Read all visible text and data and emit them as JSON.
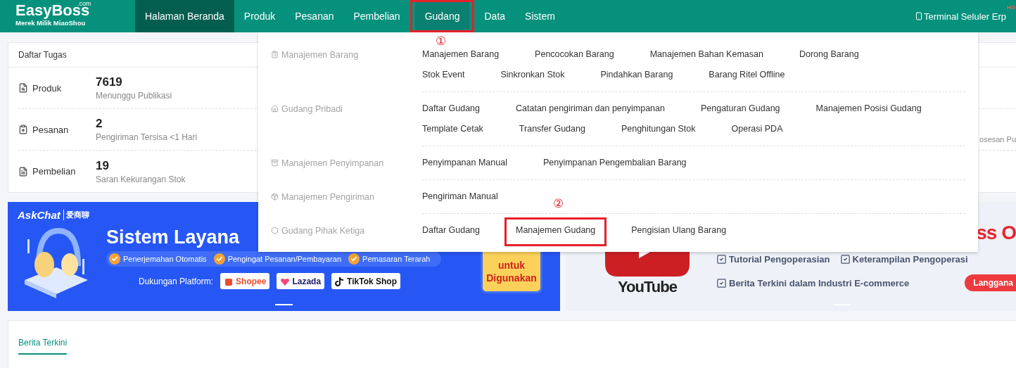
{
  "header": {
    "logo": {
      "name": "EasyBoss",
      "domain": ".com",
      "tagline": "Merek Milik MiaoShou"
    },
    "nav": [
      {
        "label": "Halaman Beranda",
        "selected": true,
        "open": false
      },
      {
        "label": "Produk",
        "selected": false,
        "open": false
      },
      {
        "label": "Pesanan",
        "selected": false,
        "open": false
      },
      {
        "label": "Pembelian",
        "selected": false,
        "open": false
      },
      {
        "label": "Gudang",
        "selected": false,
        "open": true,
        "callout": "①"
      },
      {
        "label": "Data",
        "selected": false,
        "open": false
      },
      {
        "label": "Sistem",
        "selected": false,
        "open": false
      }
    ],
    "mobile_link": {
      "label": "Terminal Seluler Erp",
      "badge": "HO"
    }
  },
  "tasks": {
    "title": "Daftar Tugas",
    "rows": [
      {
        "label": "Produk",
        "count": "7619",
        "caption": "Menunggu Publikasi"
      },
      {
        "label": "Pesanan",
        "count": "2",
        "caption": "Pengiriman Tersisa <1 Hari",
        "column_2": "osesan Pu"
      },
      {
        "label": "Pembelian",
        "count": "19",
        "caption": "Saran Kekurangan Stok"
      }
    ]
  },
  "banners": {
    "left": {
      "brand": "AskChat",
      "brand_cn": "爱商聊",
      "title": "Sistem Layana",
      "features": [
        "Penerjemahan Otomatis",
        "Pengingat Pesanan/Pembayaran",
        "Pemasaran Terarah"
      ],
      "platform_label": "Dukungan Platform:",
      "platforms": [
        "Shopee",
        "Lazada",
        "**TikTok** Shop"
      ],
      "promo": [
        "untuk",
        "Digunakan"
      ]
    },
    "right": {
      "headline": "ss O",
      "video_brand": "YouTube",
      "checklist": [
        "Tutorial Pengoperasian",
        "Keterampilan Pengoperasi",
        "Berita Terkini dalam Industri E-commerce"
      ],
      "button": "Langgana"
    }
  },
  "news": {
    "tabs": [
      {
        "label": "Berita Terkini",
        "selected": true
      }
    ]
  },
  "menu": {
    "groups": [
      {
        "label": "Manajemen Barang",
        "items": [
          {
            "label": "Manajemen Barang"
          },
          {
            "label": "Pencocokan Barang"
          },
          {
            "label": "Manajemen Bahan Kemasan"
          },
          {
            "label": "Dorong Barang"
          },
          {
            "label": "Stok Event"
          },
          {
            "label": "Sinkronkan Stok"
          },
          {
            "label": "Pindahkan Barang"
          },
          {
            "label": "Barang Ritel Offline"
          }
        ]
      },
      {
        "label": "Gudang Pribadi",
        "items": [
          {
            "label": "Daftar Gudang"
          },
          {
            "label": "Catatan pengiriman dan penyimpanan"
          },
          {
            "label": "Pengaturan Gudang"
          },
          {
            "label": "Manajemen Posisi Gudang"
          },
          {
            "label": "Template Cetak"
          },
          {
            "label": "Transfer Gudang"
          },
          {
            "label": "Penghitungan Stok"
          },
          {
            "label": "Operasi PDA"
          }
        ]
      },
      {
        "label": "Manajemen Penyimpanan",
        "items": [
          {
            "label": "Penyimpanan Manual"
          },
          {
            "label": "Penyimpanan Pengembalian Barang"
          }
        ]
      },
      {
        "label": "Manajemen Pengiriman",
        "items": [
          {
            "label": "Pengiriman Manual"
          }
        ]
      },
      {
        "label": "Gudang Pihak Ketiga",
        "items": [
          {
            "label": "Daftar Gudang"
          },
          {
            "label": "Manajemen Gudang",
            "callout": "②"
          },
          {
            "label": "Pengisian Ulang Barang"
          }
        ]
      }
    ]
  }
}
